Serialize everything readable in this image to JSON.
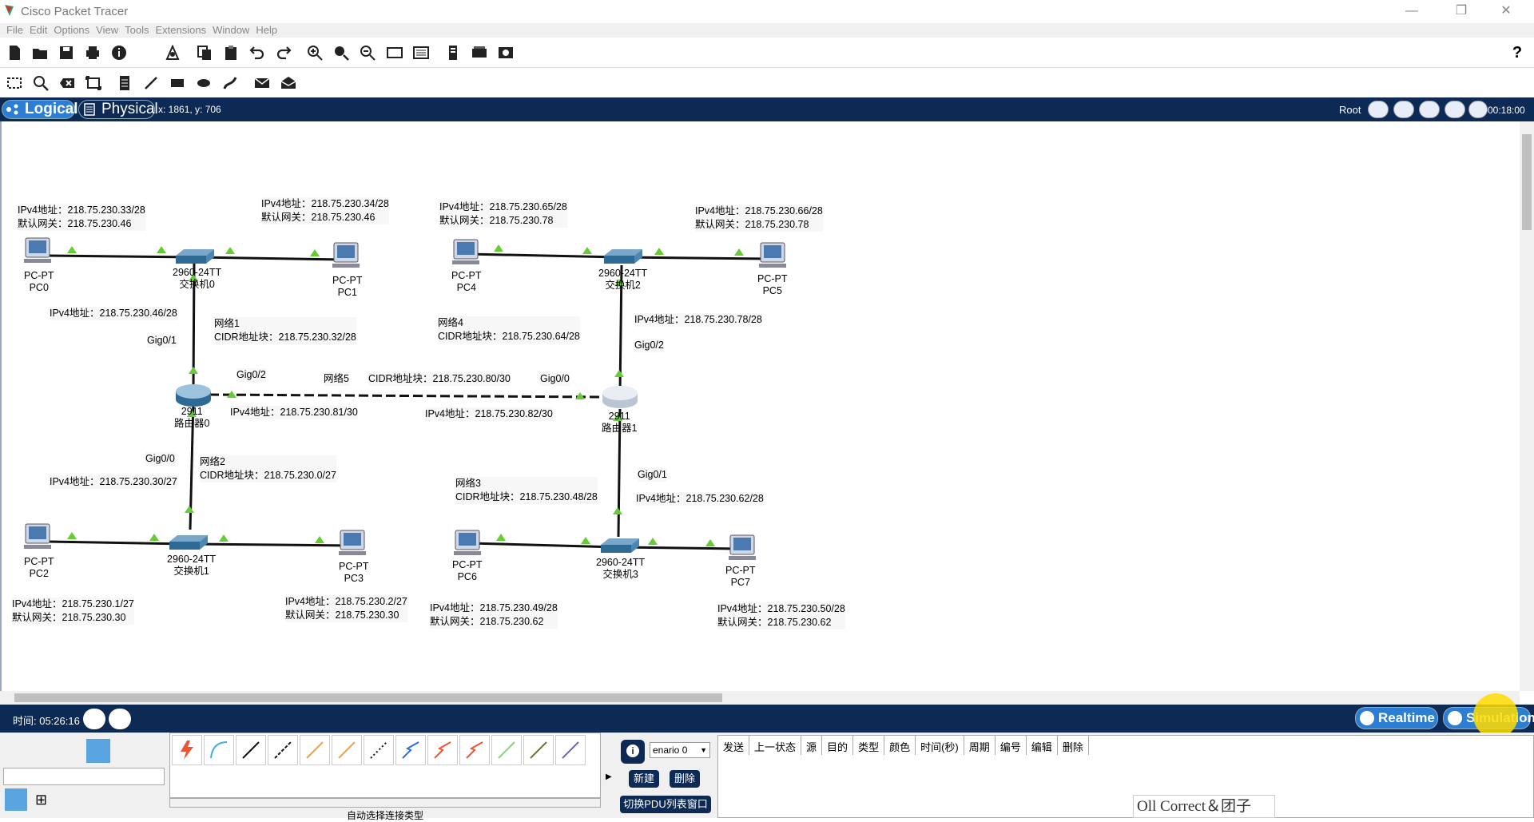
{
  "window": {
    "title": "Cisco Packet Tracer",
    "minimize": "—",
    "restore": "❐",
    "close": "✕"
  },
  "menu": [
    "File",
    "Edit",
    "Options",
    "View",
    "Tools",
    "Extensions",
    "Window",
    "Help"
  ],
  "nav": {
    "logical": "Logical",
    "physical": "Physical",
    "coords": "x: 1861, y: 706",
    "root": "Root",
    "clock": "00:18:00"
  },
  "devices": [
    {
      "name": "PC-PT",
      "label": "PC0"
    },
    {
      "name": "PC-PT",
      "label": "PC1"
    },
    {
      "name": "PC-PT",
      "label": "PC2"
    },
    {
      "name": "PC-PT",
      "label": "PC3"
    },
    {
      "name": "PC-PT",
      "label": "PC4"
    },
    {
      "name": "PC-PT",
      "label": "PC5"
    },
    {
      "name": "PC-PT",
      "label": "PC6"
    },
    {
      "name": "PC-PT",
      "label": "PC7"
    },
    {
      "name": "2960-24TT",
      "label": "交换机0"
    },
    {
      "name": "2960-24TT",
      "label": "交换机1"
    },
    {
      "name": "2960-24TT",
      "label": "交换机2"
    },
    {
      "name": "2960-24TT",
      "label": "交换机3"
    },
    {
      "name": "2911",
      "label": "路由器0"
    },
    {
      "name": "2911",
      "label": "路由器1"
    }
  ],
  "notes": [
    "IPv4地址：218.75.230.33/28\n默认网关：218.75.230.46",
    "IPv4地址：218.75.230.34/28\n默认网关：218.75.230.46",
    "IPv4地址：218.75.230.65/28\n默认网关：218.75.230.78",
    "IPv4地址：218.75.230.66/28\n默认网关：218.75.230.78",
    "IPv4地址：218.75.230.46/28",
    "网络1\nCIDR地址块：218.75.230.32/28",
    "网络4\nCIDR地址块：218.75.230.64/28",
    "IPv4地址：218.75.230.78/28",
    "Gig0/1",
    "Gig0/2",
    "Gig0/2",
    "网络5",
    "CIDR地址块：218.75.230.80/30",
    "Gig0/0",
    "IPv4地址：218.75.230.81/30",
    "IPv4地址：218.75.230.82/30",
    "Gig0/0",
    "网络2\nCIDR地址块：218.75.230.0/27",
    "IPv4地址：218.75.230.30/27",
    "Gig0/1",
    "网络3\nCIDR地址块：218.75.230.48/28",
    "IPv4地址：218.75.230.62/28",
    "IPv4地址：218.75.230.1/27\n默认网关：218.75.230.30",
    "IPv4地址：218.75.230.2/27\n默认网关：218.75.230.30",
    "IPv4地址：218.75.230.49/28\n默认网关：218.75.230.62",
    "IPv4地址：218.75.230.50/28\n默认网关：218.75.230.62"
  ],
  "status": {
    "time": "时间: 05:26:16",
    "realtime": "Realtime",
    "simulation": "Simulation"
  },
  "bottom": {
    "conn_type_label": "自动选择连接类型",
    "scenario": "enario 0",
    "new_btn": "新建",
    "delete_btn": "删除",
    "toggle_pdu": "切换PDU列表窗口",
    "pdu_columns": [
      "发送",
      "上一状态",
      "源",
      "目的",
      "类型",
      "颜色",
      "时间(秒)",
      "周期",
      "编号",
      "编辑",
      "删除"
    ],
    "watermark": "Oll Correct＆团子"
  },
  "colors": {
    "nav_bg": "#0d2a55",
    "accent": "#2a7fd4",
    "link_green": "#66cc33"
  }
}
